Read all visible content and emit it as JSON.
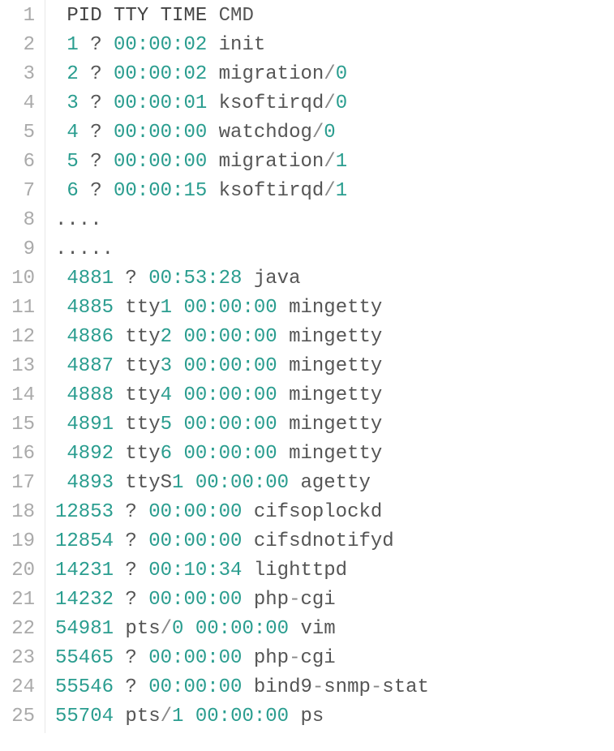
{
  "header": {
    "pid": "PID",
    "tty": "TTY",
    "time": "TIME",
    "cmd": "CMD"
  },
  "lines": [
    {
      "lineno": "1",
      "type": "header"
    },
    {
      "lineno": "2",
      "type": "row",
      "pid": "1",
      "tty": "?",
      "time": "00:00:02",
      "cmd": "init",
      "cmd_split": null
    },
    {
      "lineno": "3",
      "type": "row",
      "pid": "2",
      "tty": "?",
      "time": "00:00:02",
      "cmd": "migration",
      "cmd_split": "/0"
    },
    {
      "lineno": "4",
      "type": "row",
      "pid": "3",
      "tty": "?",
      "time": "00:00:01",
      "cmd": "ksoftirqd",
      "cmd_split": "/0"
    },
    {
      "lineno": "5",
      "type": "row",
      "pid": "4",
      "tty": "?",
      "time": "00:00:00",
      "cmd": "watchdog",
      "cmd_split": "/0"
    },
    {
      "lineno": "6",
      "type": "row",
      "pid": "5",
      "tty": "?",
      "time": "00:00:00",
      "cmd": "migration",
      "cmd_split": "/1"
    },
    {
      "lineno": "7",
      "type": "row",
      "pid": "6",
      "tty": "?",
      "time": "00:00:15",
      "cmd": "ksoftirqd",
      "cmd_split": "/1"
    },
    {
      "lineno": "8",
      "type": "dots",
      "text": "...."
    },
    {
      "lineno": "9",
      "type": "dots",
      "text": "....."
    },
    {
      "lineno": "10",
      "type": "row2",
      "pid": "4881",
      "tty": "?",
      "time": "00:53:28",
      "cmd": "java",
      "cmd_split": null
    },
    {
      "lineno": "11",
      "type": "row2",
      "pid": "4885",
      "tty": "tty1",
      "time": "00:00:00",
      "cmd": "mingetty",
      "cmd_split": null
    },
    {
      "lineno": "12",
      "type": "row2",
      "pid": "4886",
      "tty": "tty2",
      "time": "00:00:00",
      "cmd": "mingetty",
      "cmd_split": null
    },
    {
      "lineno": "13",
      "type": "row2",
      "pid": "4887",
      "tty": "tty3",
      "time": "00:00:00",
      "cmd": "mingetty",
      "cmd_split": null
    },
    {
      "lineno": "14",
      "type": "row2",
      "pid": "4888",
      "tty": "tty4",
      "time": "00:00:00",
      "cmd": "mingetty",
      "cmd_split": null
    },
    {
      "lineno": "15",
      "type": "row2",
      "pid": "4891",
      "tty": "tty5",
      "time": "00:00:00",
      "cmd": "mingetty",
      "cmd_split": null
    },
    {
      "lineno": "16",
      "type": "row2",
      "pid": "4892",
      "tty": "tty6",
      "time": "00:00:00",
      "cmd": "mingetty",
      "cmd_split": null
    },
    {
      "lineno": "17",
      "type": "row2",
      "pid": "4893",
      "tty": "ttyS1",
      "time": "00:00:00",
      "cmd": "agetty",
      "cmd_split": null
    },
    {
      "lineno": "18",
      "type": "row3",
      "pid": "12853",
      "tty": "?",
      "time": "00:00:00",
      "cmd": "cifsoplockd",
      "cmd_split": null
    },
    {
      "lineno": "19",
      "type": "row3",
      "pid": "12854",
      "tty": "?",
      "time": "00:00:00",
      "cmd": "cifsdnotifyd",
      "cmd_split": null
    },
    {
      "lineno": "20",
      "type": "row3",
      "pid": "14231",
      "tty": "?",
      "time": "00:10:34",
      "cmd": "lighttpd",
      "cmd_split": null
    },
    {
      "lineno": "21",
      "type": "row3",
      "pid": "14232",
      "tty": "?",
      "time": "00:00:00",
      "cmd": "php",
      "cmd_split": "-cgi"
    },
    {
      "lineno": "22",
      "type": "row3",
      "pid": "54981",
      "tty": "pts/0",
      "time": "00:00:00",
      "cmd": "vim",
      "cmd_split": null,
      "tty_split": true
    },
    {
      "lineno": "23",
      "type": "row3",
      "pid": "55465",
      "tty": "?",
      "time": "00:00:00",
      "cmd": "php",
      "cmd_split": "-cgi"
    },
    {
      "lineno": "24",
      "type": "row3",
      "pid": "55546",
      "tty": "?",
      "time": "00:00:00",
      "cmd": "bind9-snmp-",
      "cmd_split": null,
      "cmd_tail": "stat",
      "multi": true
    },
    {
      "lineno": "25",
      "type": "row3",
      "pid": "55704",
      "tty": "pts/1",
      "time": "00:00:00",
      "cmd": "ps",
      "cmd_split": null,
      "tty_split": true
    }
  ]
}
